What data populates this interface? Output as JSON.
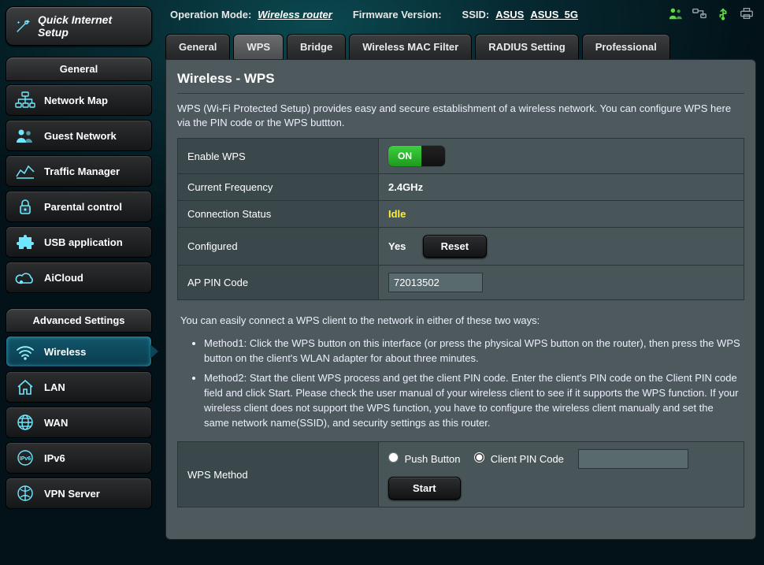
{
  "header": {
    "op_mode_label": "Operation Mode:",
    "op_mode_value": "Wireless router",
    "fw_label": "Firmware Version:",
    "ssid_label": "SSID:",
    "ssid1": "ASUS",
    "ssid2": "ASUS_5G"
  },
  "qis_label": "Quick Internet Setup",
  "sidebar": {
    "general_header": "General",
    "general_items": [
      {
        "label": "Network Map"
      },
      {
        "label": "Guest Network"
      },
      {
        "label": "Traffic Manager"
      },
      {
        "label": "Parental control"
      },
      {
        "label": "USB application"
      },
      {
        "label": "AiCloud"
      }
    ],
    "adv_header": "Advanced Settings",
    "adv_items": [
      {
        "label": "Wireless"
      },
      {
        "label": "LAN"
      },
      {
        "label": "WAN"
      },
      {
        "label": "IPv6"
      },
      {
        "label": "VPN Server"
      }
    ]
  },
  "tabs": [
    "General",
    "WPS",
    "Bridge",
    "Wireless MAC Filter",
    "RADIUS Setting",
    "Professional"
  ],
  "page": {
    "title": "Wireless - WPS",
    "intro": "WPS (Wi-Fi Protected Setup) provides easy and secure establishment of a wireless network. You can configure WPS here via the PIN code or the WPS buttton.",
    "rows": {
      "enable_label": "Enable WPS",
      "toggle_on": "ON",
      "freq_label": "Current Frequency",
      "freq_value": "2.4GHz",
      "conn_label": "Connection Status",
      "conn_value": "Idle",
      "conf_label": "Configured",
      "conf_value": "Yes",
      "reset_btn": "Reset",
      "pin_label": "AP PIN Code",
      "pin_value": "72013502"
    },
    "help_intro": "You can easily connect a WPS client to the network in either of these two ways:",
    "help_m1": "Method1: Click the WPS button on this interface (or press the physical WPS button on the router), then press the WPS button on the client's WLAN adapter for about three minutes.",
    "help_m2": "Method2: Start the client WPS process and get the client PIN code. Enter the client's PIN code on the Client PIN code field and click Start. Please check the user manual of your wireless client to see if it supports the WPS function. If your wireless client does not support the WPS function, you have to configure the wireless client manually and set the same network name(SSID), and security settings as this router.",
    "method_label": "WPS Method",
    "radio_push": "Push Button",
    "radio_pin": "Client PIN Code",
    "start_btn": "Start"
  }
}
